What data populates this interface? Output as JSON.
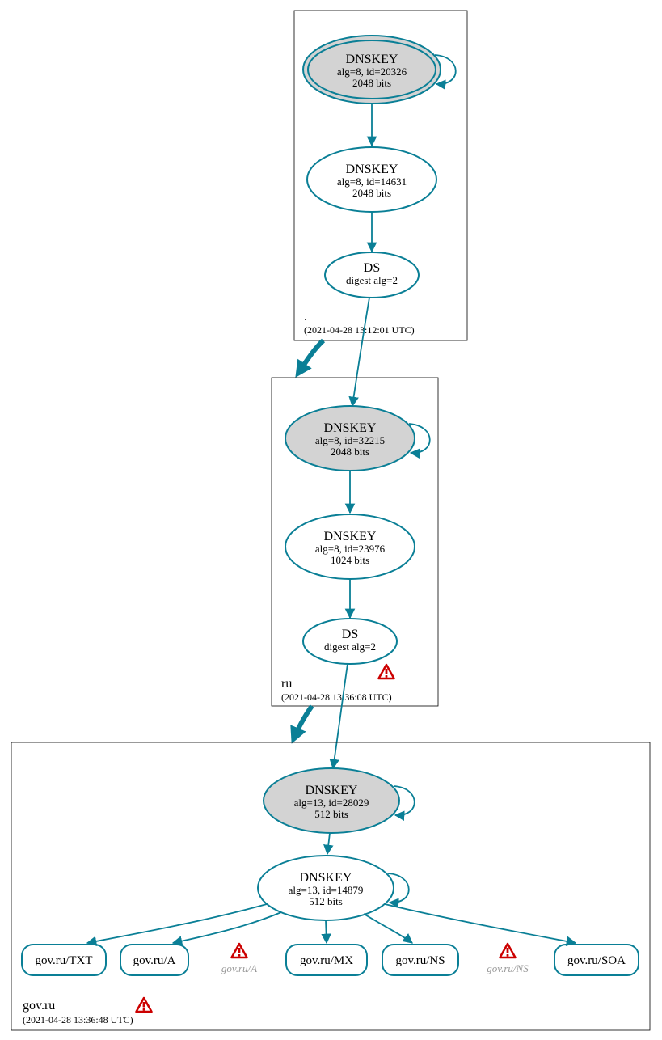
{
  "zones": {
    "root": {
      "name": ".",
      "timestamp": "(2021-04-28 13:12:01 UTC)",
      "ksk": {
        "title": "DNSKEY",
        "alg": "alg=8, id=20326",
        "bits": "2048 bits"
      },
      "zsk": {
        "title": "DNSKEY",
        "alg": "alg=8, id=14631",
        "bits": "2048 bits"
      },
      "ds": {
        "title": "DS",
        "alg": "digest alg=2"
      }
    },
    "ru": {
      "name": "ru",
      "timestamp": "(2021-04-28 13:36:08 UTC)",
      "ksk": {
        "title": "DNSKEY",
        "alg": "alg=8, id=32215",
        "bits": "2048 bits"
      },
      "zsk": {
        "title": "DNSKEY",
        "alg": "alg=8, id=23976",
        "bits": "1024 bits"
      },
      "ds": {
        "title": "DS",
        "alg": "digest alg=2"
      }
    },
    "govru": {
      "name": "gov.ru",
      "timestamp": "(2021-04-28 13:36:48 UTC)",
      "ksk": {
        "title": "DNSKEY",
        "alg": "alg=13, id=28029",
        "bits": "512 bits"
      },
      "zsk": {
        "title": "DNSKEY",
        "alg": "alg=13, id=14879",
        "bits": "512 bits"
      }
    }
  },
  "rrsets": {
    "txt": "gov.ru/TXT",
    "a": "gov.ru/A",
    "a_nx": "gov.ru/A",
    "mx": "gov.ru/MX",
    "ns": "gov.ru/NS",
    "ns_nx": "gov.ru/NS",
    "soa": "gov.ru/SOA"
  }
}
